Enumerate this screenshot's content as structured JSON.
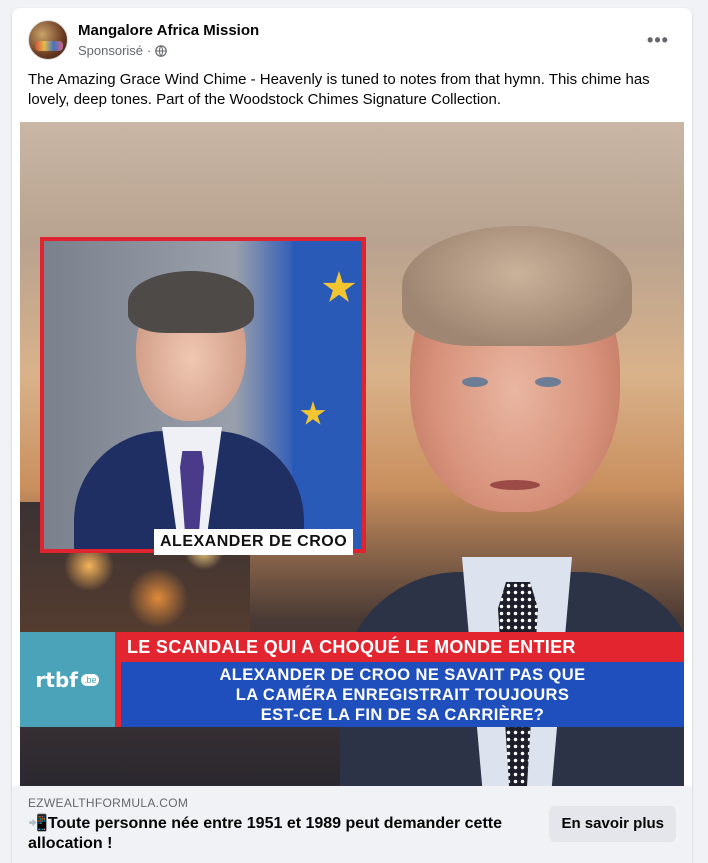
{
  "post": {
    "page_name": "Mangalore Africa Mission",
    "sponsored_label": "Sponsorisé",
    "separator": "·",
    "body_text": "The Amazing Grace Wind Chime - Heavenly is tuned to notes from that hymn. This chime has lovely, deep tones. Part of the Woodstock Chimes Signature Collection.",
    "more_icon_glyph": "•••"
  },
  "image": {
    "inset_name": "ALEXANDER DE CROO",
    "logo_text": "rtbf",
    "logo_suffix": ".be",
    "banner_headline": "LE SCANDALE QUI A CHOQUÉ LE MONDE ENTIER",
    "banner_lines": [
      "ALEXANDER DE CROO NE SAVAIT PAS QUE",
      "LA CAMÉRA ENREGISTRAIT TOUJOURS",
      "EST-CE LA FIN DE SA CARRIÈRE?"
    ]
  },
  "link": {
    "domain": "EZWEALTHFORMULA.COM",
    "headline_emoji": "📲",
    "headline": "Toute personne née entre 1951 et 1989 peut demander cette allocation !",
    "cta_label": "En savoir plus"
  },
  "colors": {
    "banner_red": "#e32530",
    "banner_blue": "#1f4fbd",
    "logo_teal": "#4aa3b8",
    "secondary_text": "#65676b"
  },
  "icons": [
    "globe-icon",
    "more-options-icon"
  ]
}
